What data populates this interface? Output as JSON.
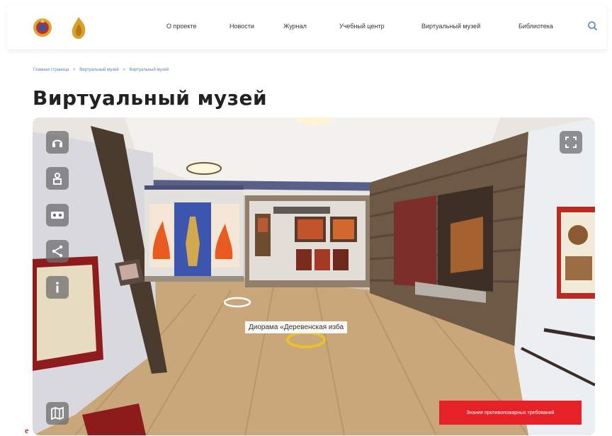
{
  "header": {
    "nav": [
      {
        "label": "О проекте"
      },
      {
        "label": "Новости"
      },
      {
        "label": "Журнал"
      },
      {
        "label": "Учебный центр"
      },
      {
        "label": "Виртуальный музей"
      },
      {
        "label": "Библиотека"
      }
    ],
    "icons": {
      "search": "search-icon",
      "logo_primary": "emblem-icon",
      "logo_secondary": "flame-emblem-icon"
    }
  },
  "breadcrumb": [
    "Главная страница",
    "Виртуальный музей",
    "Виртуальный музей"
  ],
  "breadcrumb_separator": ">",
  "page": {
    "title": "Виртуальный музей"
  },
  "viewer": {
    "controls": [
      "headphones-icon",
      "person-icon",
      "vr-goggles-icon",
      "share-icon",
      "info-icon",
      "map-icon",
      "fullscreen-icon"
    ],
    "hotspot_label": "Диорама «Деревенская изба",
    "cta_label": "Знание противопожарных требований"
  },
  "stray_glyph": "e",
  "colors": {
    "accent": "#e62228",
    "breadcrumb": "#5b7fb3",
    "title": "#222222",
    "control_bg": "#6e6e6e"
  }
}
